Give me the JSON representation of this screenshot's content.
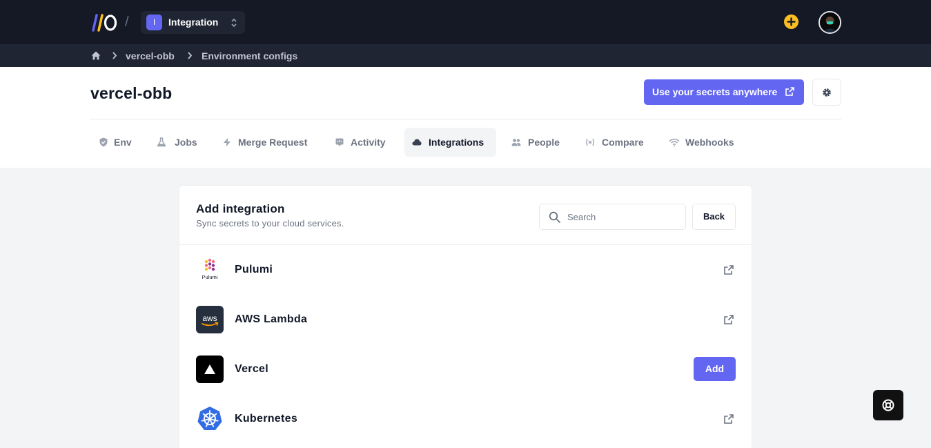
{
  "topbar": {
    "logo_text": "//O",
    "separator": "/",
    "org": {
      "badge": "I",
      "name": "Integration"
    }
  },
  "breadcrumb": {
    "items": [
      "vercel-obb",
      "Environment configs"
    ]
  },
  "header": {
    "title": "vercel-obb",
    "secrets_button": "Use your secrets anywhere"
  },
  "tabs": [
    {
      "label": "Env",
      "icon": "shield-icon",
      "active": false
    },
    {
      "label": "Jobs",
      "icon": "flask-icon",
      "active": false
    },
    {
      "label": "Merge Request",
      "icon": "bolt-icon",
      "active": false
    },
    {
      "label": "Activity",
      "icon": "activity-icon",
      "active": false
    },
    {
      "label": "Integrations",
      "icon": "cloud-icon",
      "active": true
    },
    {
      "label": "People",
      "icon": "people-icon",
      "active": false
    },
    {
      "label": "Compare",
      "icon": "variable-icon",
      "active": false
    },
    {
      "label": "Webhooks",
      "icon": "wifi-icon",
      "active": false
    }
  ],
  "card": {
    "title": "Add integration",
    "subtitle": "Sync secrets to your cloud services.",
    "search_placeholder": "Search",
    "search_value": "",
    "back_label": "Back",
    "integrations": [
      {
        "name": "Pulumi",
        "logo_text": "Pulumi",
        "action": "external-link"
      },
      {
        "name": "AWS Lambda",
        "logo_text": "aws",
        "action": "external-link"
      },
      {
        "name": "Vercel",
        "action": "add",
        "add_label": "Add"
      },
      {
        "name": "Kubernetes",
        "action": "external-link"
      }
    ]
  },
  "colors": {
    "accent": "#6366f1",
    "topbar": "#141925",
    "crumbbar": "#1f2533",
    "plus": "#fbbf24"
  }
}
